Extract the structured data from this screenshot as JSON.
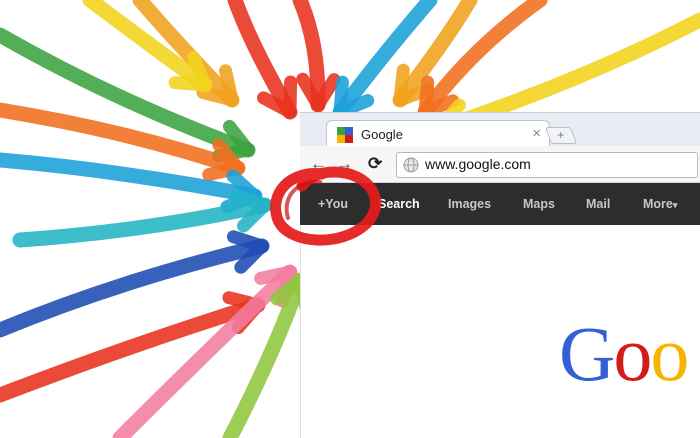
{
  "colors": {
    "arrows": [
      "#3aa340",
      "#f0a21c",
      "#e8311d",
      "#2b7ad4",
      "#f3d31a",
      "#8fc63d",
      "#1aa0d8",
      "#f06e1e",
      "#22b3c5",
      "#f27ca1",
      "#1c4bb3"
    ],
    "marker_circle": "#e51b1b",
    "gbar_bg": "#2d2d2d"
  },
  "browser": {
    "tab": {
      "title": "Google",
      "favicon": "google-favicon",
      "close_icon": "×",
      "new_tab_icon": "+"
    },
    "toolbar": {
      "back_icon": "←",
      "forward_icon": "→",
      "reload_icon": "⟳",
      "url": "www.google.com"
    }
  },
  "gbar": {
    "items": [
      "+You",
      "Search",
      "Images",
      "Maps",
      "Mail",
      "More"
    ],
    "more_suffix": "▾",
    "active_index": 1
  },
  "logo": {
    "letters": [
      "G",
      "o",
      "o"
    ],
    "colors": [
      "#3360d6",
      "#d31b1b",
      "#f5b400"
    ]
  }
}
